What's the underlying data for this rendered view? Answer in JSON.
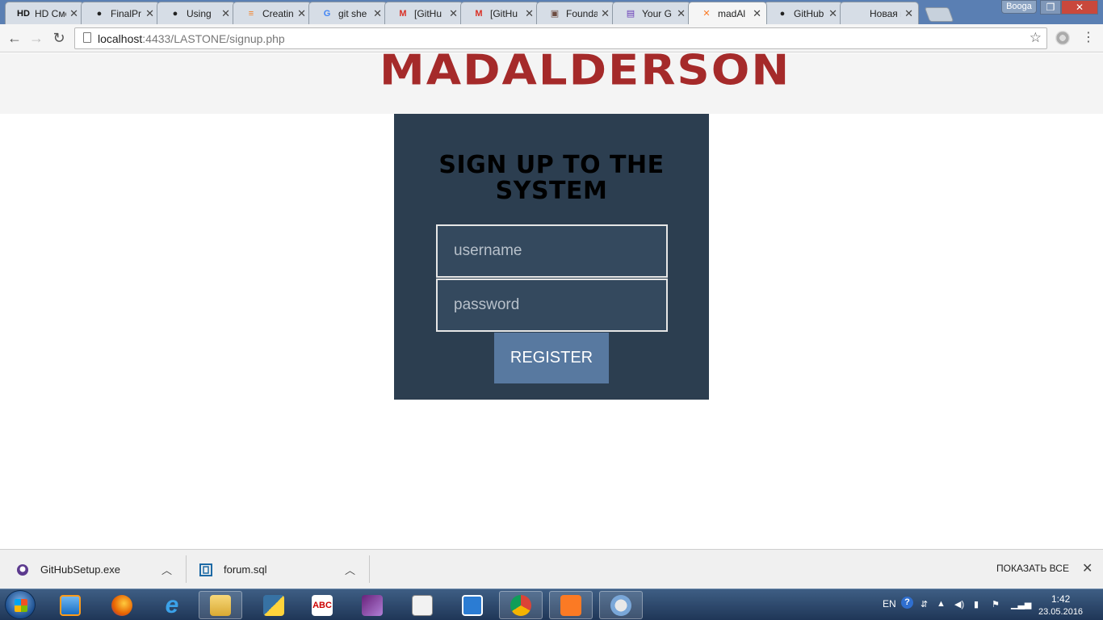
{
  "browser": {
    "tabs": [
      {
        "label": "HD Смотр",
        "favicon": "hd-icon",
        "fav_text": "HD",
        "fav_color": "#111111"
      },
      {
        "label": "FinalPr",
        "favicon": "github-icon",
        "fav_text": "●",
        "fav_color": "#222222"
      },
      {
        "label": "Using",
        "favicon": "github-icon",
        "fav_text": "●",
        "fav_color": "#222222"
      },
      {
        "label": "Creatin",
        "favicon": "stackoverflow-icon",
        "fav_text": "≡",
        "fav_color": "#f48024"
      },
      {
        "label": "git she",
        "favicon": "google-icon",
        "fav_text": "G",
        "fav_color": "#4285f4"
      },
      {
        "label": "[GitHu",
        "favicon": "gmail-icon",
        "fav_text": "M",
        "fav_color": "#d93025"
      },
      {
        "label": "[GitHu",
        "favicon": "gmail-icon",
        "fav_text": "M",
        "fav_color": "#d93025"
      },
      {
        "label": "Founda",
        "favicon": "contact-icon",
        "fav_text": "▣",
        "fav_color": "#6d4c41"
      },
      {
        "label": "Your G",
        "favicon": "form-icon",
        "fav_text": "▤",
        "fav_color": "#673ab7"
      },
      {
        "label": "madAl",
        "favicon": "xampp-icon",
        "fav_text": "✕",
        "fav_color": "#fb7a24",
        "active": true
      },
      {
        "label": "GitHub",
        "favicon": "github-icon",
        "fav_text": "●",
        "fav_color": "#222222"
      },
      {
        "label": "Новая вкл",
        "favicon": "blank-icon",
        "fav_text": "",
        "fav_color": "#999999"
      }
    ],
    "tab_close_glyph": "✕",
    "user_name": "Booga",
    "url_host": "localhost",
    "url_path": ":4433/LASTONE/signup.php"
  },
  "page": {
    "logo_text": "MADALDERSON",
    "card_title": "SIGN UP TO THE SYSTEM",
    "username_placeholder": "username",
    "password_placeholder": "password",
    "register_label": "REGISTER"
  },
  "downloads": {
    "items": [
      {
        "name": "GitHubSetup.exe",
        "icon": "github-setup-icon"
      },
      {
        "name": "forum.sql",
        "icon": "sql-file-icon"
      }
    ],
    "show_all": "ПОКАЗАТЬ ВСЕ"
  },
  "taskbar": {
    "lang": "EN",
    "time": "1:42",
    "date": "23.05.2016"
  },
  "colors": {
    "logo": "#a52a2a",
    "card_bg": "#2c3e50",
    "field_bg": "#34495e",
    "button_bg": "#5879a0"
  }
}
